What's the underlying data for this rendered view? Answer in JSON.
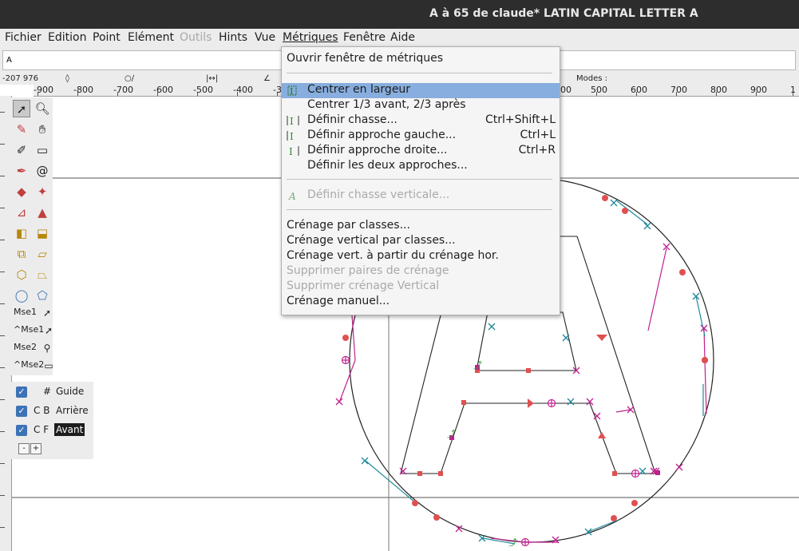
{
  "window": {
    "title": "A à 65 de claude* LATIN CAPITAL LETTER A"
  },
  "menubar": {
    "items": [
      {
        "label": "Fichier",
        "state": "normal"
      },
      {
        "label": "Edition",
        "state": "normal"
      },
      {
        "label": "Point",
        "state": "normal"
      },
      {
        "label": "Elément",
        "state": "normal"
      },
      {
        "label": "Outils",
        "state": "disabled"
      },
      {
        "label": "Hints",
        "state": "normal"
      },
      {
        "label": "Vue",
        "state": "normal"
      },
      {
        "label": "Métriques",
        "state": "open"
      },
      {
        "label": "Fenêtre",
        "state": "normal"
      },
      {
        "label": "Aide",
        "state": "normal"
      }
    ]
  },
  "glyph_input": {
    "value": "A"
  },
  "infobar": {
    "coords": "-207 976",
    "modes_label": "Modes :"
  },
  "hruler": {
    "labels": [
      "-900",
      "-800",
      "-700",
      "-600",
      "-500",
      "-400",
      "-3",
      "00",
      "500",
      "600",
      "700",
      "800",
      "900",
      "1"
    ]
  },
  "tools": {
    "mse1": "Mse1",
    "ctrl_mse1": "^Mse1",
    "mse2": "Mse2",
    "ctrl_mse2": "^Mse2"
  },
  "layers": [
    {
      "checked": true,
      "tag": "#",
      "name": "Guide",
      "active": false
    },
    {
      "checked": true,
      "tag": "C B",
      "name": "Arrière",
      "active": false
    },
    {
      "checked": true,
      "tag": "C F",
      "name": "Avant",
      "active": true
    }
  ],
  "layer_buttons": {
    "remove": "-",
    "add": "+"
  },
  "metrics_menu": {
    "items": [
      {
        "type": "item",
        "label": "Ouvrir fenêtre de métriques",
        "accel": "",
        "icon": "",
        "state": "normal",
        "indent": false
      },
      {
        "type": "sep"
      },
      {
        "type": "item",
        "label": "Centrer en largeur",
        "accel": "",
        "icon": "center-width-icon",
        "state": "highlighted",
        "indent": true
      },
      {
        "type": "item",
        "label": "Centrer 1/3 avant, 2/3 après",
        "accel": "",
        "icon": "",
        "state": "normal",
        "indent": true
      },
      {
        "type": "item",
        "label": "Définir chasse...",
        "accel": "Ctrl+Shift+L",
        "icon": "set-width-icon",
        "state": "normal",
        "indent": true
      },
      {
        "type": "item",
        "label": "Définir approche gauche...",
        "accel": "Ctrl+L",
        "icon": "set-lbearing-icon",
        "state": "normal",
        "indent": true
      },
      {
        "type": "item",
        "label": "Définir approche droite...",
        "accel": "Ctrl+R",
        "icon": "set-rbearing-icon",
        "state": "normal",
        "indent": true
      },
      {
        "type": "item",
        "label": "Définir les deux approches...",
        "accel": "",
        "icon": "",
        "state": "normal",
        "indent": true
      },
      {
        "type": "sep"
      },
      {
        "type": "item",
        "label": "Définir chasse verticale...",
        "accel": "",
        "icon": "set-vwidth-icon",
        "state": "disabled",
        "indent": true
      },
      {
        "type": "sep"
      },
      {
        "type": "item",
        "label": "Crénage par classes...",
        "accel": "",
        "icon": "",
        "state": "normal",
        "indent": false
      },
      {
        "type": "item",
        "label": "Crénage vertical par classes...",
        "accel": "",
        "icon": "",
        "state": "normal",
        "indent": false
      },
      {
        "type": "item",
        "label": "Crénage vert. à partir du crénage hor.",
        "accel": "",
        "icon": "",
        "state": "normal",
        "indent": false
      },
      {
        "type": "item",
        "label": "Supprimer paires de crénage",
        "accel": "",
        "icon": "",
        "state": "disabled",
        "indent": false
      },
      {
        "type": "item",
        "label": "Supprimer crénage Vertical",
        "accel": "",
        "icon": "",
        "state": "disabled",
        "indent": false
      },
      {
        "type": "item",
        "label": "Crénage manuel...",
        "accel": "",
        "icon": "",
        "state": "normal",
        "indent": false
      }
    ]
  },
  "colors": {
    "point_red": "#e05050",
    "point_magenta": "#c0208f",
    "point_teal": "#1f8a9a",
    "highlight": "#87aede"
  }
}
